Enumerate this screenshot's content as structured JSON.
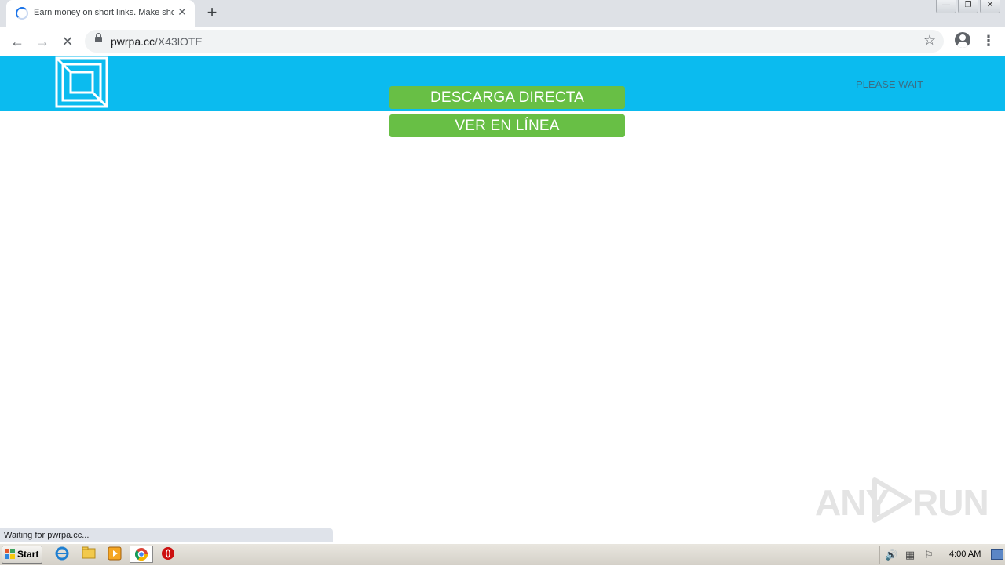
{
  "browser": {
    "tab_title": "Earn money on short links. Make short links and earn the biggest money",
    "tab_close": "✕",
    "new_tab": "+",
    "url_host": "pwrpa.cc",
    "url_path": "/X43lOTE",
    "back": "←",
    "forward": "→",
    "stop": "✕",
    "bookmark": "☆",
    "menu": "⋮",
    "window_controls": {
      "minimize": "—",
      "restore": "❐",
      "close": "✕"
    }
  },
  "page": {
    "please_wait": "PLEASE WAIT",
    "buttons": {
      "descarga": "DESCARGA DIRECTA",
      "ver": "VER EN LÍNEA"
    },
    "colors": {
      "header": "#0bbbef",
      "button": "#68bf45"
    }
  },
  "watermark": {
    "left": "ANY",
    "right": "RUN"
  },
  "status_bar": "Waiting for pwrpa.cc...",
  "taskbar": {
    "start": "Start",
    "clock": "4:00 AM",
    "apps": [
      "internet-explorer-icon",
      "folder-icon",
      "media-player-icon",
      "chrome-icon",
      "opera-icon"
    ]
  }
}
